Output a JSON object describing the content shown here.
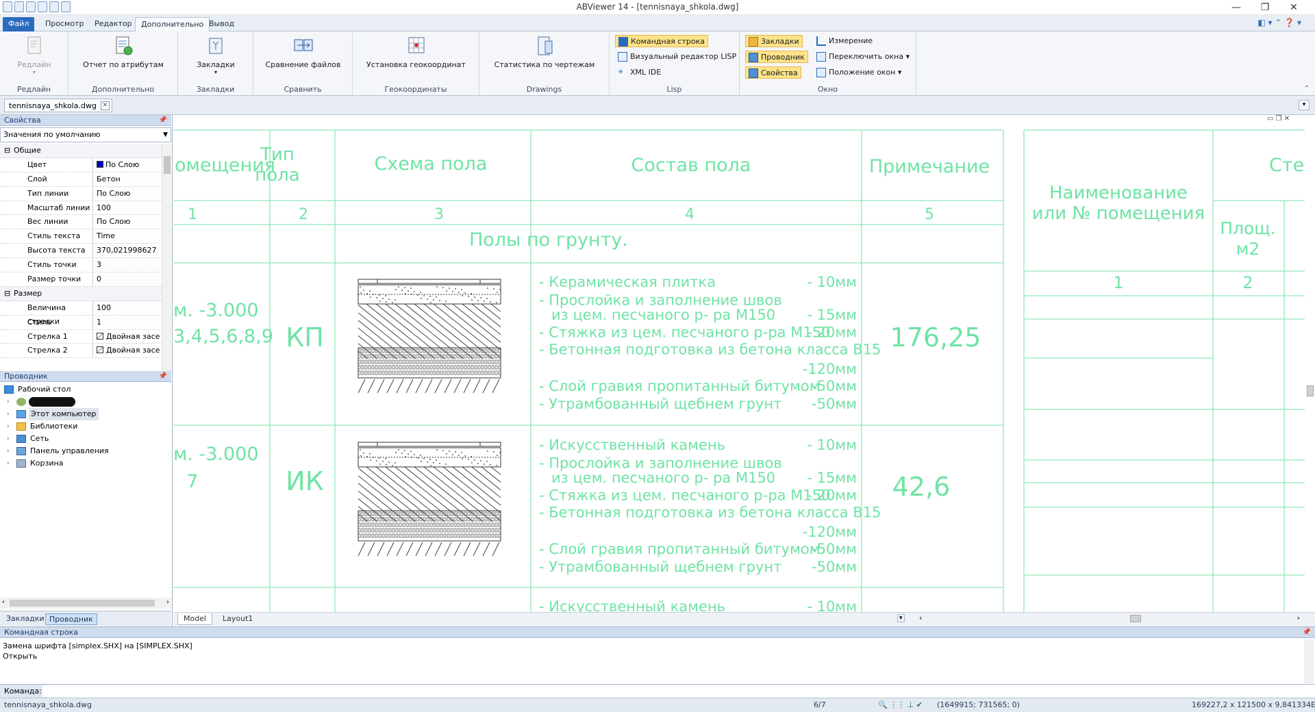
{
  "window": {
    "title": "ABViewer 14 - [tennisnaya_shkola.dwg]",
    "controls": [
      "—",
      "❐",
      "✕"
    ]
  },
  "menu_tabs": [
    "Файл",
    "Просмотр",
    "Редактор",
    "Дополнительно",
    "Вывод"
  ],
  "ribbon": {
    "groups": {
      "redline": {
        "button": "Редлайн",
        "label": "Редлайн"
      },
      "extra": {
        "button": "Отчет по атрибутам",
        "label": "Дополнительно"
      },
      "bookmarks": {
        "button": "Закладки",
        "label": "Закладки"
      },
      "compare": {
        "button": "Сравнение файлов",
        "label": "Сравнить"
      },
      "geo": {
        "button": "Установка геокоординат",
        "label": "Геокоординаты"
      },
      "drawings": {
        "button": "Статистика по чертежам",
        "label": "Drawings"
      },
      "lisp": {
        "label": "Lisp",
        "items": [
          "Командная строка",
          "Визуальный редактор LISP",
          "XML IDE"
        ]
      },
      "window": {
        "label": "Окно",
        "toggles": [
          "Закладки",
          "Проводник",
          "Свойства"
        ],
        "items": [
          "Измерение",
          "Переключить окна",
          "Положение окон"
        ]
      }
    }
  },
  "doc_tab": {
    "name": "tennisnaya_shkola.dwg"
  },
  "properties": {
    "title": "Свойства",
    "preset": "Значения по умолчанию",
    "rows": [
      {
        "cat": true,
        "k": "Общие",
        "v": ""
      },
      {
        "k": "Цвет",
        "v": "По Слою",
        "swatch": "#0000cc"
      },
      {
        "k": "Слой",
        "v": "Бетон"
      },
      {
        "k": "Тип линии",
        "v": "По Слою"
      },
      {
        "k": "Масштаб линии",
        "v": "100"
      },
      {
        "k": "Вес линии",
        "v": "По Слою"
      },
      {
        "k": "Стиль текста",
        "v": "Time"
      },
      {
        "k": "Высота текста",
        "v": "370,021998627"
      },
      {
        "k": "Стиль точки",
        "v": "3"
      },
      {
        "k": "Размер точки",
        "v": "0"
      },
      {
        "cat": true,
        "k": "Размер",
        "v": ""
      },
      {
        "k": "Величина стрелки",
        "v": "100"
      },
      {
        "k": "Стиль",
        "v": "1"
      },
      {
        "k": "Стрелка 1",
        "v": "Двойная засе",
        "check": true
      },
      {
        "k": "Стрелка 2",
        "v": "Двойная засе",
        "check": true
      }
    ]
  },
  "explorer": {
    "title": "Проводник",
    "items": [
      "Рабочий стол",
      "",
      "Этот компьютер",
      "Библиотеки",
      "Сеть",
      "Панель управления",
      "Корзина"
    ]
  },
  "left_tabs": [
    "Закладки",
    "Проводник"
  ],
  "drawing": {
    "headers": {
      "room": "омещения",
      "type_l1": "Тип",
      "type_l2": "пола",
      "scheme": "Схема пола",
      "composition": "Состав пола",
      "note": "Примечание"
    },
    "col_numbers": [
      "1",
      "2",
      "3",
      "4",
      "5"
    ],
    "section": "Полы по грунту.",
    "rows": [
      {
        "room_l1": "м. -3.000",
        "room_l2": "3,4,5,6,8,9",
        "type": "КП",
        "note": "176,25",
        "layers": [
          [
            "- Керамическая плитка",
            "- 10мм"
          ],
          [
            "- Прослойка и заполнение швов",
            ""
          ],
          [
            "из цем. песчаного р- ра М150",
            "- 15мм"
          ],
          [
            "- Стяжка из цем. песчаного р-ра  М150",
            "- 20мм"
          ],
          [
            "- Бетонная подготовка из бетона класса В15",
            ""
          ],
          [
            "",
            "-120мм"
          ],
          [
            "- Слой гравия пропитанный битумом",
            "-50мм"
          ],
          [
            "- Утрамбованный щебнем грунт",
            "-50мм"
          ]
        ]
      },
      {
        "room_l1": "м. -3.000",
        "room_l2": "7",
        "type": "ИК",
        "note": "42,6",
        "layers": [
          [
            "- Искусственный камень",
            "- 10мм"
          ],
          [
            "- Прослойка и заполнение швов",
            ""
          ],
          [
            "из цем. песчаного р- ра М150",
            "- 15мм"
          ],
          [
            "- Стяжка из цем. песчаного р-ра  М150",
            "- 20мм"
          ],
          [
            "- Бетонная подготовка из бетона класса В15",
            ""
          ],
          [
            "",
            "-120мм"
          ],
          [
            "- Слой гравия пропитанный битумом",
            "-50мм"
          ],
          [
            "- Утрамбованный щебнем грунт",
            "-50мм"
          ]
        ]
      },
      {
        "layers": [
          [
            "- Искусственный камень",
            "- 10мм"
          ]
        ]
      }
    ],
    "right_table": {
      "name_l1": "Наименование",
      "name_l2": "или № помещения",
      "area_l1": "Площ.",
      "area_l2": "м2",
      "cut": "Сте",
      "num1": "1",
      "num2": "2"
    },
    "color": "#6fe3a5"
  },
  "layout_tabs": [
    "Model",
    "Layout1"
  ],
  "command": {
    "title": "Командная строка",
    "lines": [
      "Замена шрифта [simplex.SHX] на [SIMPLEX.SHX]",
      "Открыть"
    ],
    "prompt": "Команда:"
  },
  "status": {
    "file": "tennisnaya_shkola.dwg",
    "page": "6/7",
    "coords": "(1649915; 731565; 0)",
    "dims": "169227,2 x 121500 x 9,841334E-11"
  }
}
